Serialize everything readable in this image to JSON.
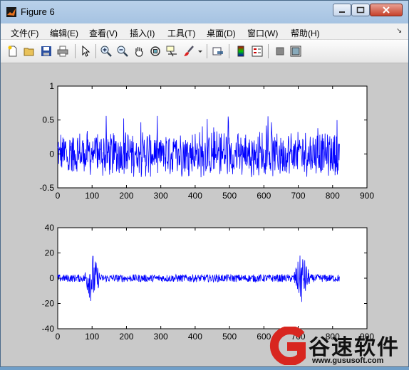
{
  "window": {
    "title": "Figure 6"
  },
  "menu": [
    "文件(F)",
    "编辑(E)",
    "查看(V)",
    "插入(I)",
    "工具(T)",
    "桌面(D)",
    "窗口(W)",
    "帮助(H)"
  ],
  "toolbar_icons": [
    "new-figure-icon",
    "open-file-icon",
    "save-icon",
    "print-icon",
    "edit-plot-arrow-icon",
    "zoom-in-icon",
    "zoom-out-icon",
    "pan-hand-icon",
    "rotate-3d-icon",
    "data-cursor-icon",
    "brush-icon",
    "brush-dropdown-icon",
    "link-plot-icon",
    "colorbar-icon",
    "legend-icon",
    "hide-plot-tools-icon",
    "show-plot-tools-icon"
  ],
  "chart_data": [
    {
      "type": "line",
      "x_range": [
        0,
        820
      ],
      "xlim": [
        0,
        900
      ],
      "ylim": [
        -0.5,
        1
      ],
      "xticks": [
        "0",
        "100",
        "200",
        "300",
        "400",
        "500",
        "600",
        "700",
        "800",
        "900"
      ],
      "yticks": [
        "-0.5",
        "0",
        "0.5",
        "1"
      ],
      "color": "#0000ff",
      "description_values": {
        "typical_amplitude": 0.25,
        "peak_max": 0.55,
        "peak_min": -0.5
      }
    },
    {
      "type": "line",
      "x_range": [
        0,
        820
      ],
      "xlim": [
        0,
        900
      ],
      "ylim": [
        -40,
        40
      ],
      "xticks": [
        "0",
        "100",
        "200",
        "300",
        "400",
        "500",
        "600",
        "700",
        "800",
        "900"
      ],
      "yticks": [
        "-40",
        "-20",
        "0",
        "20",
        "40"
      ],
      "color": "#0000ff",
      "bursts": [
        {
          "center": 100,
          "amplitude": 25
        },
        {
          "center": 710,
          "amplitude": 25
        }
      ],
      "baseline_amplitude": 4
    }
  ],
  "watermark": {
    "text": "谷速软件",
    "url": "www.gususoft.com"
  }
}
